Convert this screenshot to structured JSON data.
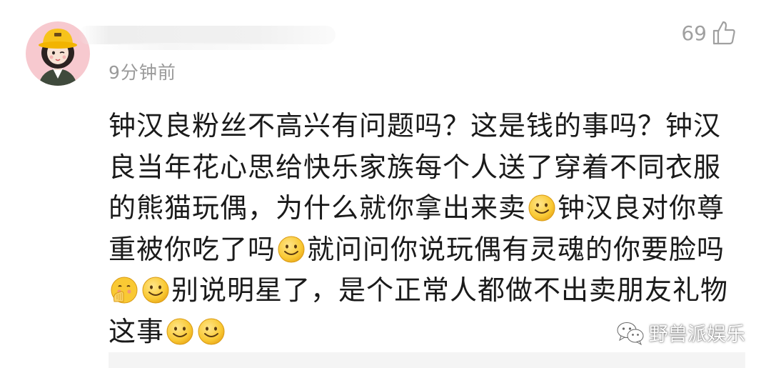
{
  "comment": {
    "timestamp": "9分钟前",
    "like_count": "69",
    "segments": [
      {
        "type": "text",
        "value": "钟汉良粉丝不高兴有问题吗？这是钱的事吗？钟汉良当年花心思给快乐家族每个人送了穿着不同衣服的熊猫玩偶，为什么就你拿出来卖"
      },
      {
        "type": "emoji",
        "icon": "smile-emoji-icon"
      },
      {
        "type": "text",
        "value": "钟汉良对你尊重被你吃了吗"
      },
      {
        "type": "emoji",
        "icon": "smile-emoji-icon"
      },
      {
        "type": "text",
        "value": "就问问你说玩偶有灵魂的你要脸吗"
      },
      {
        "type": "emoji",
        "icon": "facepalm-emoji-icon"
      },
      {
        "type": "emoji",
        "icon": "smile-emoji-icon"
      },
      {
        "type": "text",
        "value": "别说明星了，是个正常人都做不出卖朋友礼物这事"
      },
      {
        "type": "emoji",
        "icon": "smile-emoji-icon"
      },
      {
        "type": "emoji",
        "icon": "smile-emoji-icon"
      }
    ]
  },
  "watermark": {
    "text": "野兽派娱乐",
    "icon": "wechat-icon"
  },
  "icons": {
    "like": "thumbs-up-icon",
    "avatar": "avatar-image"
  },
  "colors": {
    "text_primary": "#1a1a1a",
    "text_secondary": "#9a9a9a",
    "avatar_bg": "#f7c9cf",
    "emoji_yellow": "#f9c934"
  }
}
